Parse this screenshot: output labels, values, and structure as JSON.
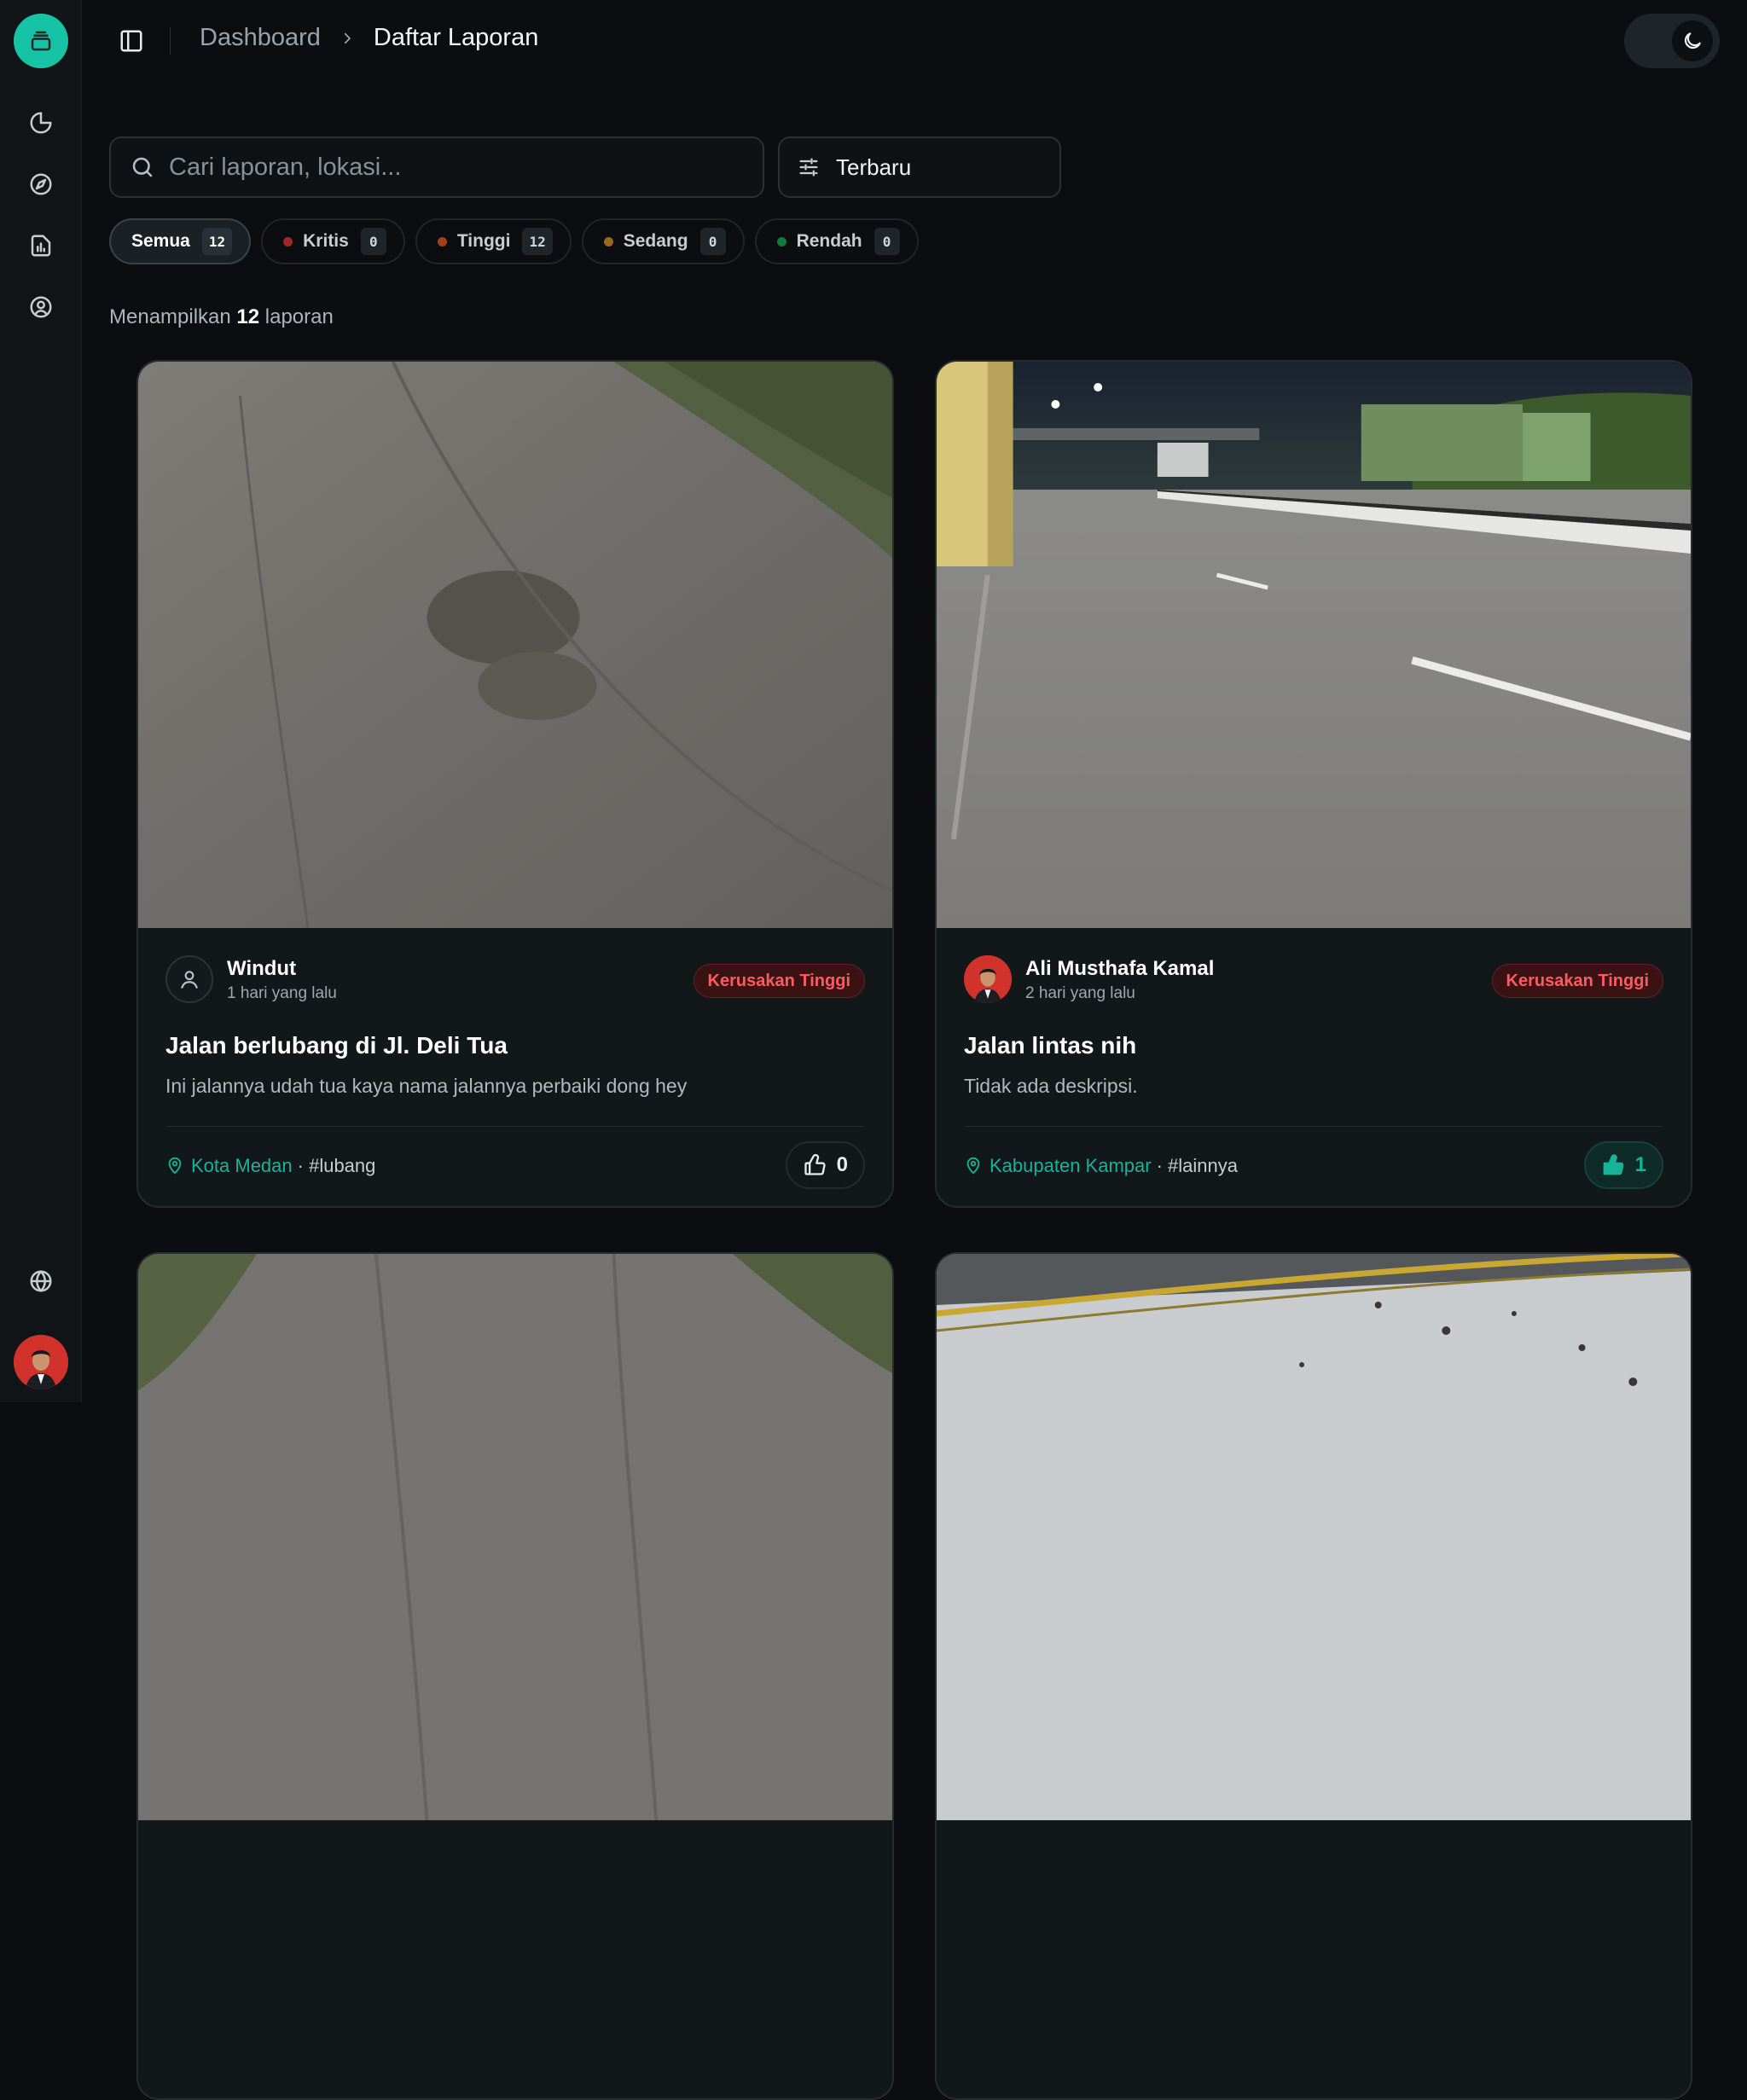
{
  "breadcrumb": {
    "parent": "Dashboard",
    "current": "Daftar Laporan"
  },
  "search": {
    "placeholder": "Cari laporan, lokasi...",
    "value": ""
  },
  "sort": {
    "label": "Terbaru"
  },
  "filters": [
    {
      "label": "Semua",
      "count": "12",
      "color": ""
    },
    {
      "label": "Kritis",
      "count": "0",
      "color": "#c9302c"
    },
    {
      "label": "Tinggi",
      "count": "12",
      "color": "#c2410c"
    },
    {
      "label": "Sedang",
      "count": "0",
      "color": "#b7791f"
    },
    {
      "label": "Rendah",
      "count": "0",
      "color": "#15803d"
    }
  ],
  "result": {
    "prefix": "Menampilkan",
    "count": "12",
    "suffix": "laporan"
  },
  "reports": [
    {
      "author": "Windut",
      "time": "1 hari yang lalu",
      "severity": "Kerusakan Tinggi",
      "title": "Jalan berlubang di Jl. Deli Tua",
      "description": "Ini jalannya udah tua kaya nama jalannya perbaiki dong hey",
      "location": "Kota Medan",
      "tag": "· #lubang",
      "likes": "0"
    },
    {
      "author": "Ali Musthafa Kamal",
      "time": "2 hari yang lalu",
      "severity": "Kerusakan Tinggi",
      "title": "Jalan lintas nih",
      "description": "Tidak ada deskripsi.",
      "location": "Kabupaten Kampar",
      "tag": "· #lainnya",
      "likes": "1"
    }
  ],
  "colors": {
    "accent": "#17c3a6",
    "danger": "#ff5b5f",
    "background": "#0b0d10"
  }
}
